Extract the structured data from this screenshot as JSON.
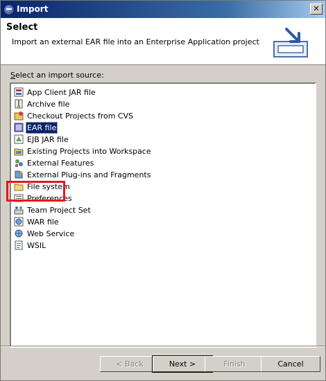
{
  "window": {
    "title": "Import"
  },
  "banner": {
    "heading": "Select",
    "description": "Import an external EAR file into an Enterprise Application project",
    "icon": "import-wizard-icon"
  },
  "source": {
    "label_accel": "S",
    "label_rest": "elect an import source:",
    "items": [
      {
        "label": "App Client JAR file",
        "icon": "jar-icon"
      },
      {
        "label": "Archive file",
        "icon": "archive-icon"
      },
      {
        "label": "Checkout Projects from CVS",
        "icon": "cvs-icon"
      },
      {
        "label": "EAR file",
        "icon": "ear-icon",
        "selected": true
      },
      {
        "label": "EJB JAR file",
        "icon": "ejb-jar-icon"
      },
      {
        "label": "Existing Projects into Workspace",
        "icon": "project-folder-icon"
      },
      {
        "label": "External Features",
        "icon": "feature-icon"
      },
      {
        "label": "External Plug-ins and Fragments",
        "icon": "plugin-icon"
      },
      {
        "label": "File system",
        "icon": "folder-icon"
      },
      {
        "label": "Preferences",
        "icon": "preferences-icon"
      },
      {
        "label": "Team Project Set",
        "icon": "team-icon"
      },
      {
        "label": "WAR file",
        "icon": "war-icon"
      },
      {
        "label": "Web Service",
        "icon": "web-service-icon"
      },
      {
        "label": "WSIL",
        "icon": "wsil-icon"
      }
    ]
  },
  "buttons": {
    "back": "< Back",
    "next": "Next >",
    "finish": "Finish",
    "cancel": "Cancel"
  },
  "colors": {
    "selection": "#0a246a",
    "annotation": "#e8151f"
  }
}
